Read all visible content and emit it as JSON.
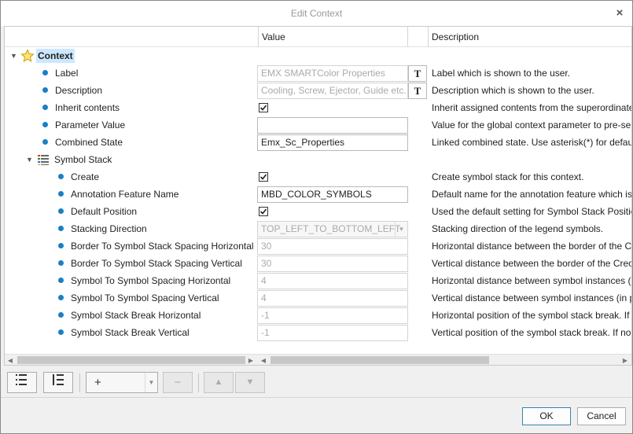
{
  "window": {
    "title": "Edit Context",
    "close_icon": "×"
  },
  "columns": {
    "value": "Value",
    "description": "Description"
  },
  "root": {
    "label": "Context",
    "icon": "star-icon"
  },
  "properties": [
    {
      "label": "Label",
      "kind": "text",
      "value": "EMX SMARTColor Properties",
      "disabled": true,
      "button": "T",
      "description": "Label which is shown to the user."
    },
    {
      "label": "Description",
      "kind": "text",
      "value": "Cooling, Screw, Ejector, Guide etc.",
      "disabled": true,
      "button": "T",
      "description": "Description which is shown to the user."
    },
    {
      "label": "Inherit contents",
      "kind": "check",
      "checked": true,
      "description": "Inherit assigned contents from the superordinate"
    },
    {
      "label": "Parameter Value",
      "kind": "text",
      "value": "",
      "description": "Value for the global context parameter to pre-se"
    },
    {
      "label": "Combined State",
      "kind": "text",
      "value": "Emx_Sc_Properties",
      "description": "Linked combined state. Use asterisk(*) for defaul"
    }
  ],
  "symbol_stack": {
    "label": "Symbol Stack",
    "icon": "list-icon",
    "items": [
      {
        "label": "Create",
        "kind": "check",
        "checked": true,
        "description": "Create symbol stack for this context."
      },
      {
        "label": "Annotation Feature Name",
        "kind": "text",
        "value": "MBD_COLOR_SYMBOLS",
        "description": "Default name for the annotation feature which is"
      },
      {
        "label": "Default Position",
        "kind": "check",
        "checked": true,
        "description": "Used the default setting for Symbol Stack Positio"
      },
      {
        "label": "Stacking Direction",
        "kind": "combo",
        "value": "TOP_LEFT_TO_BOTTOM_LEFT",
        "description": "Stacking direction of the legend symbols."
      },
      {
        "label": "Border To Symbol Stack Spacing Horizontal",
        "kind": "text",
        "value": "30",
        "disabled": true,
        "description": "Horizontal distance between the border of the C"
      },
      {
        "label": "Border To Symbol Stack Spacing Vertical",
        "kind": "text",
        "value": "30",
        "disabled": true,
        "description": "Vertical distance between the border of the Creo"
      },
      {
        "label": "Symbol To Symbol Spacing Horizontal",
        "kind": "text",
        "value": "4",
        "disabled": true,
        "description": "Horizontal distance between symbol instances (i"
      },
      {
        "label": "Symbol To Symbol Spacing Vertical",
        "kind": "text",
        "value": "4",
        "disabled": true,
        "description": "Vertical distance between symbol instances (in p"
      },
      {
        "label": "Symbol Stack Break Horizontal",
        "kind": "text",
        "value": "-1",
        "disabled": true,
        "description": "Horizontal position of the symbol stack break. If"
      },
      {
        "label": "Symbol Stack Break Vertical",
        "kind": "text",
        "value": "-1",
        "disabled": true,
        "description": "Vertical position of the symbol stack break. If no"
      }
    ]
  },
  "toolbar": {
    "expand_all_icon": "expand-all-icon",
    "collapse_all_icon": "collapse-all-icon",
    "add_icon": "+",
    "remove_icon": "−",
    "move_up_icon": "▲",
    "move_down_icon": "▼"
  },
  "buttons": {
    "ok": "OK",
    "cancel": "Cancel"
  },
  "colors": {
    "bullet": "#1b7fc4",
    "selection": "#cce8ff"
  }
}
